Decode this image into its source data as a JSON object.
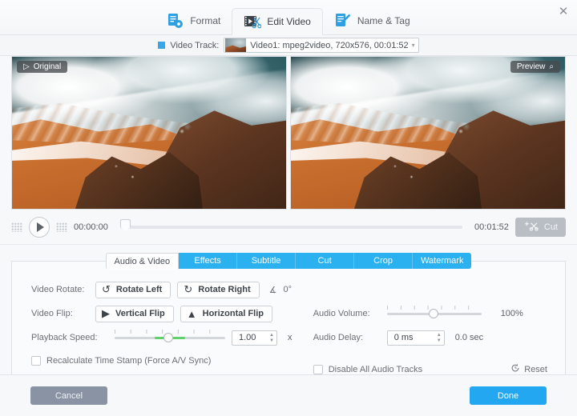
{
  "window": {
    "close_icon": "close-icon"
  },
  "tabs": [
    {
      "label": "Format",
      "icon": "format-icon",
      "active": false
    },
    {
      "label": "Edit Video",
      "icon": "edit-video-icon",
      "active": true
    },
    {
      "label": "Name & Tag",
      "icon": "name-tag-icon",
      "active": false
    }
  ],
  "track": {
    "label": "Video Track:",
    "selected": "Video1: mpeg2video, 720x576, 00:01:52",
    "caret": "▾"
  },
  "preview": {
    "original_badge": "Original",
    "original_icon": "play-triangle-icon",
    "preview_badge": "Preview",
    "preview_icon": "magnifier-icon"
  },
  "transport": {
    "play_icon": "play-icon",
    "current_time": "00:00:00",
    "total_time": "00:01:52",
    "cut_label": "Cut",
    "cut_icon": "add-scissors-icon",
    "position_percent": 0
  },
  "subtabs": [
    {
      "label": "Audio & Video",
      "active": true
    },
    {
      "label": "Effects",
      "active": false
    },
    {
      "label": "Subtitle",
      "active": false
    },
    {
      "label": "Cut",
      "active": false
    },
    {
      "label": "Crop",
      "active": false
    },
    {
      "label": "Watermark",
      "active": false
    }
  ],
  "settings": {
    "video_rotate_label": "Video Rotate:",
    "rotate_left": "Rotate Left",
    "rotate_right": "Rotate Right",
    "angle_value": "0°",
    "angle_icon": "angle-icon",
    "video_flip_label": "Video Flip:",
    "vertical_flip": "Vertical Flip",
    "horizontal_flip": "Horizontal Flip",
    "playback_speed_label": "Playback Speed:",
    "playback_speed_value": "1.00",
    "playback_speed_unit": "x",
    "recalculate_label": "Recalculate Time Stamp (Force A/V Sync)",
    "recalculate_checked": false,
    "audio_volume_label": "Audio Volume:",
    "audio_volume_value": "100%",
    "audio_delay_label": "Audio Delay:",
    "audio_delay_value": "0 ms",
    "audio_delay_seconds": "0.0 sec",
    "disable_audio_label": "Disable All Audio Tracks",
    "disable_audio_checked": false,
    "reset_label": "Reset",
    "reset_icon": "reset-icon"
  },
  "footer": {
    "cancel_label": "Cancel",
    "done_label": "Done"
  },
  "colors": {
    "accent": "#22a7f0",
    "subtab_blue": "#2bb0f0",
    "cancel_gray": "#8a93a3",
    "slider_green": "#5fd06a"
  }
}
